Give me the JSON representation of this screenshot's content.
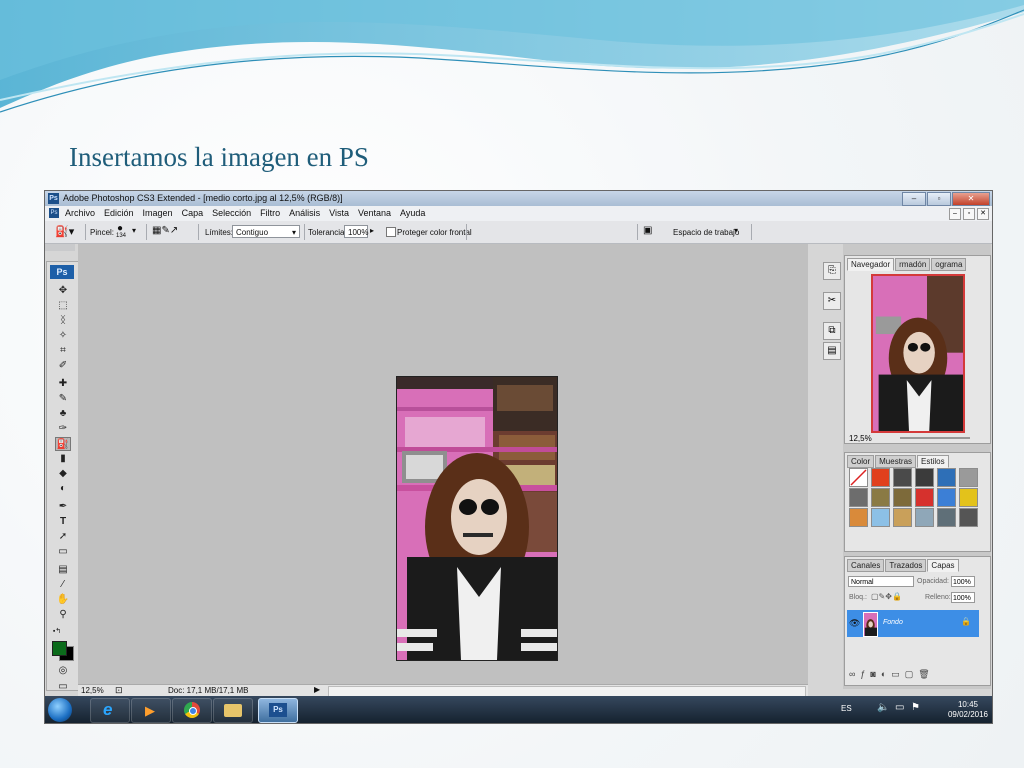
{
  "slide": {
    "title": "Insertamos la imagen en PS"
  },
  "app": {
    "icon": "Ps",
    "title": "Adobe Photoshop CS3 Extended - [medio corto.jpg al 12,5% (RGB/8)]",
    "window_controls": [
      "minimize-icon",
      "maximize-icon",
      "close-icon"
    ]
  },
  "menu": {
    "items": [
      "Archivo",
      "Edición",
      "Imagen",
      "Capa",
      "Selección",
      "Filtro",
      "Análisis",
      "Vista",
      "Ventana",
      "Ayuda"
    ]
  },
  "options_bar": {
    "brush_label": "Pincel:",
    "brush_size": "134",
    "limits_label": "Límites:",
    "limits_value": "Contiguo",
    "tolerance_label": "Tolerancia:",
    "tolerance_value": "100%",
    "protect_label": "Proteger color frontal",
    "workspace_label": "Espacio de trabajo"
  },
  "toolbox": {
    "logo": "Ps",
    "tools": [
      "move-icon",
      "marquee-icon",
      "lasso-icon",
      "quick-select-icon",
      "crop-icon",
      "eyedropper-icon",
      "healing-icon",
      "brush-icon",
      "clone-stamp-icon",
      "history-brush-icon",
      "eraser-icon",
      "gradient-icon",
      "blur-icon",
      "dodge-icon",
      "pen-icon",
      "type-icon",
      "path-select-icon",
      "shape-icon",
      "notes-icon",
      "eyedropper2-icon",
      "hand-icon",
      "zoom-icon"
    ],
    "foreground_color": "#0b6b1b",
    "background_color": "#000000"
  },
  "status": {
    "zoom": "12,5%",
    "doc": "Doc: 17,1 MB/17,1 MB"
  },
  "navigator": {
    "tabs": [
      "Navegador",
      "rmadón",
      "ograma"
    ],
    "zoom": "12,5%"
  },
  "styles_panel": {
    "tabs": [
      "Color",
      "Muestras",
      "Estilos"
    ],
    "swatches": [
      "#ffffff",
      "#e0401c",
      "#4a4a4a",
      "#3b3b3b",
      "#2e6fb7",
      "#9a9a9a",
      "#6d6d6d",
      "#8a7a44",
      "#7d6a3a",
      "#d6312d",
      "#3c7fd6",
      "#e3c21b",
      "#d98a3a",
      "#8cc0e6",
      "#c9a05a",
      "#8fa7b8",
      "#5f6f78",
      "#555555"
    ]
  },
  "layers_panel": {
    "tabs": [
      "Canales",
      "Trazados",
      "Capas"
    ],
    "blend_mode": "Normal",
    "opacity_label": "Opacidad:",
    "opacity_value": "100%",
    "lock_label": "Bloq.:",
    "fill_label": "Relleno:",
    "fill_value": "100%",
    "layer_name": "Fondo"
  },
  "taskbar": {
    "language": "ES",
    "time": "10:45",
    "date": "09/02/2016",
    "apps": [
      "internet-explorer-icon",
      "media-player-icon",
      "chrome-icon",
      "folder-icon",
      "photoshop-icon"
    ],
    "active_app_label": "Ps"
  }
}
